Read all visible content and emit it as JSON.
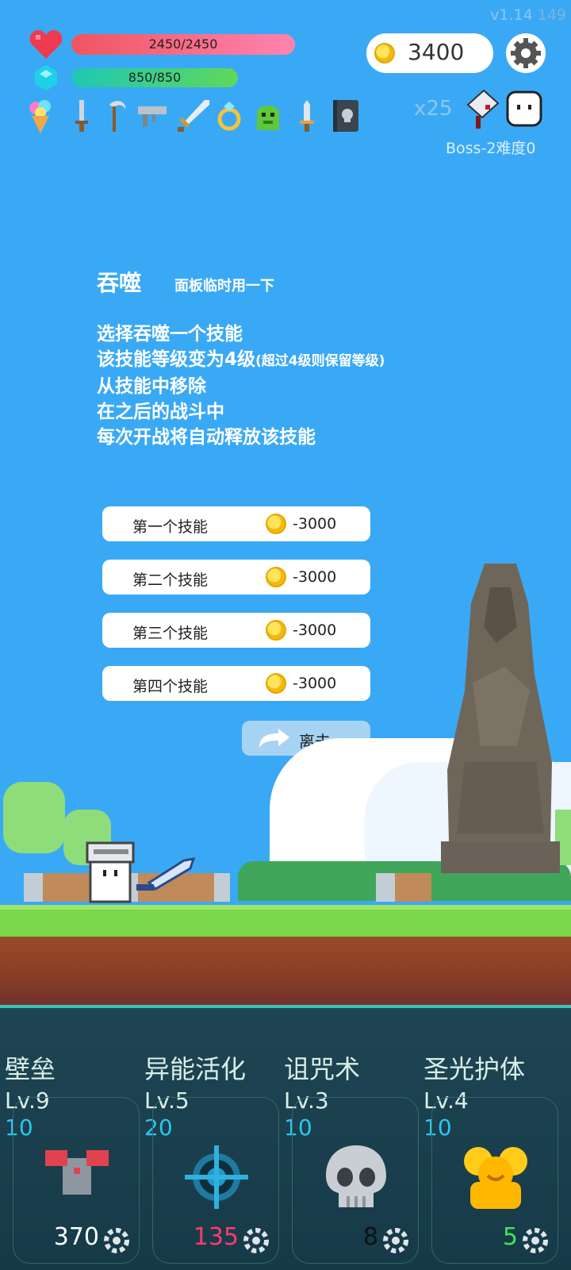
{
  "version": "v1.14",
  "fps": "149",
  "hp": {
    "text": "2450/2450",
    "fraction": 1.0
  },
  "mp": {
    "text": "850/850",
    "fraction": 1.0
  },
  "coins": "3400",
  "items": [
    "ice-cream-icon",
    "dagger-icon",
    "scythe-icon",
    "gun-icon",
    "sword-icon",
    "ring-icon",
    "green-slime-icon",
    "short-sword-icon",
    "skull-book-icon"
  ],
  "enemy": {
    "multiplier": "x25",
    "boss_text": "Boss-2难度0"
  },
  "panel": {
    "title": "吞噬",
    "subtitle": "面板临时用一下",
    "lines": [
      "选择吞噬一个技能",
      "该技能等级变为4级",
      "(超过4级则保留等级)",
      "从技能中移除",
      "在之后的战斗中",
      "每次开战将自动释放该技能"
    ]
  },
  "options": [
    {
      "label": "第一个技能",
      "cost": "-3000"
    },
    {
      "label": "第二个技能",
      "cost": "-3000"
    },
    {
      "label": "第三个技能",
      "cost": "-3000"
    },
    {
      "label": "第四个技能",
      "cost": "-3000"
    }
  ],
  "leave_label": "离去",
  "skills": [
    {
      "name": "壁垒",
      "level": "Lv.9",
      "cd": "10",
      "icon": "armor-icon",
      "count": "370",
      "count_color": "#ffffff"
    },
    {
      "name": "异能活化",
      "level": "Lv.5",
      "cd": "20",
      "icon": "target-icon",
      "count": "135",
      "count_color": "#ff3b6b"
    },
    {
      "name": "诅咒术",
      "level": "Lv.3",
      "cd": "10",
      "icon": "skull-icon",
      "count": "8",
      "count_color": "#111111"
    },
    {
      "name": "圣光护体",
      "level": "Lv.4",
      "cd": "10",
      "icon": "golden-idol-icon",
      "count": "5",
      "count_color": "#3ee45a"
    }
  ]
}
